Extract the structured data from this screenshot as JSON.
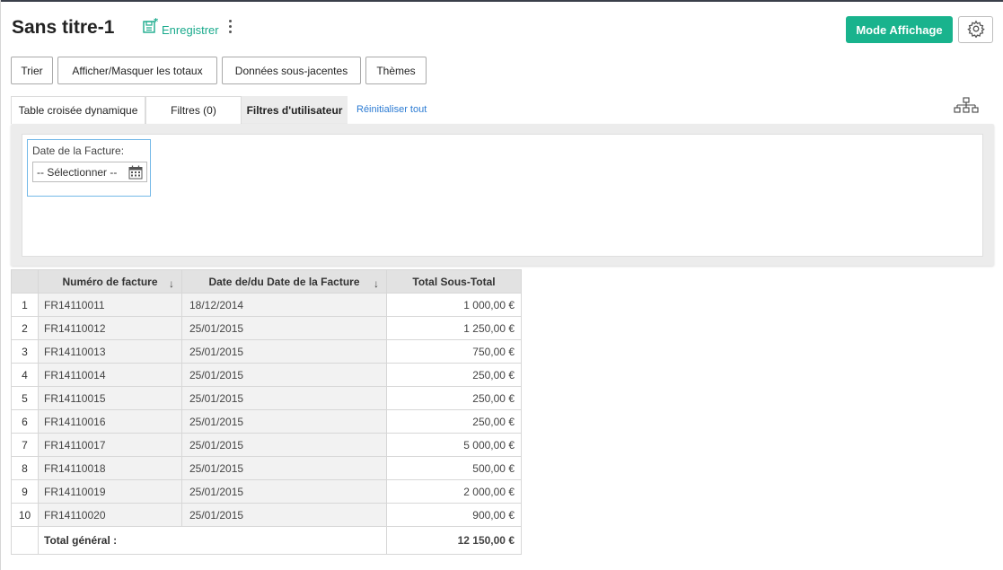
{
  "header": {
    "title": "Sans titre-1",
    "save_label": "Enregistrer",
    "mode_button": "Mode Affichage"
  },
  "toolbar": {
    "buttons": [
      "Trier",
      "Afficher/Masquer les totaux",
      "Données sous-jacentes",
      "Thèmes"
    ]
  },
  "tabs": [
    {
      "label": "Table croisée dynamique"
    },
    {
      "label": "Filtres (0)"
    },
    {
      "label": "Filtres d'utilisateur"
    }
  ],
  "reset_link": "Réinitialiser tout",
  "filter": {
    "label": "Date de la Facture:",
    "select_value": "-- Sélectionner --"
  },
  "table": {
    "columns": [
      "Numéro de facture",
      "Date de/du Date de la Facture",
      "Total Sous-Total"
    ],
    "rows": [
      {
        "num": "1",
        "invoice": "FR14110011",
        "date": "18/12/2014",
        "total": "1 000,00 €"
      },
      {
        "num": "2",
        "invoice": "FR14110012",
        "date": "25/01/2015",
        "total": "1 250,00 €"
      },
      {
        "num": "3",
        "invoice": "FR14110013",
        "date": "25/01/2015",
        "total": "750,00 €"
      },
      {
        "num": "4",
        "invoice": "FR14110014",
        "date": "25/01/2015",
        "total": "250,00 €"
      },
      {
        "num": "5",
        "invoice": "FR14110015",
        "date": "25/01/2015",
        "total": "250,00 €"
      },
      {
        "num": "6",
        "invoice": "FR14110016",
        "date": "25/01/2015",
        "total": "250,00 €"
      },
      {
        "num": "7",
        "invoice": "FR14110017",
        "date": "25/01/2015",
        "total": "5 000,00 €"
      },
      {
        "num": "8",
        "invoice": "FR14110018",
        "date": "25/01/2015",
        "total": "500,00 €"
      },
      {
        "num": "9",
        "invoice": "FR14110019",
        "date": "25/01/2015",
        "total": "2 000,00 €"
      },
      {
        "num": "10",
        "invoice": "FR14110020",
        "date": "25/01/2015",
        "total": "900,00 €"
      }
    ],
    "total_label": "Total général :",
    "total_value": "12 150,00 €"
  },
  "colors": {
    "accent": "#19b38d",
    "link": "#2b7bd3",
    "filter_border": "#74b9e8"
  }
}
